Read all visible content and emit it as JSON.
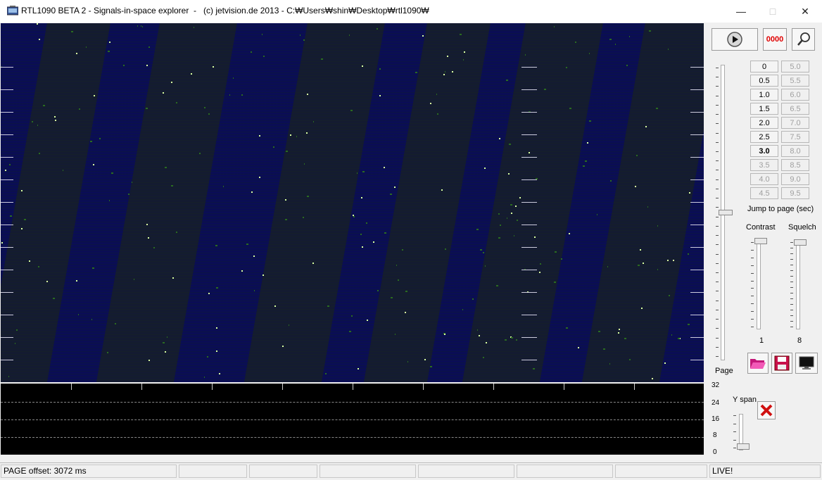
{
  "window": {
    "title": "RTL1090 BETA 2 - Signals-in-space explorer  -   (c) jetvision.de 2013 - C:₩Users₩shin₩Desktop₩rtl1090₩",
    "minimize_glyph": "—",
    "maximize_glyph": "□",
    "close_glyph": "✕"
  },
  "toolbar": {
    "play_icon": "play-icon",
    "counter_text": "0000",
    "zoom_icon": "magnifier-icon"
  },
  "jump_buttons": {
    "left": [
      {
        "label": "0",
        "state": "enabled"
      },
      {
        "label": "0.5",
        "state": "enabled"
      },
      {
        "label": "1.0",
        "state": "enabled"
      },
      {
        "label": "1.5",
        "state": "enabled"
      },
      {
        "label": "2.0",
        "state": "enabled"
      },
      {
        "label": "2.5",
        "state": "enabled"
      },
      {
        "label": "3.0",
        "state": "bold"
      },
      {
        "label": "3.5",
        "state": "disabled"
      },
      {
        "label": "4.0",
        "state": "disabled"
      },
      {
        "label": "4.5",
        "state": "disabled"
      }
    ],
    "right": [
      {
        "label": "5.0",
        "state": "disabled"
      },
      {
        "label": "5.5",
        "state": "disabled"
      },
      {
        "label": "6.0",
        "state": "disabled"
      },
      {
        "label": "6.5",
        "state": "disabled"
      },
      {
        "label": "7.0",
        "state": "disabled"
      },
      {
        "label": "7.5",
        "state": "disabled"
      },
      {
        "label": "8.0",
        "state": "disabled"
      },
      {
        "label": "8.5",
        "state": "disabled"
      },
      {
        "label": "9.0",
        "state": "disabled"
      },
      {
        "label": "9.5",
        "state": "disabled"
      }
    ],
    "caption": "Jump to page (sec)"
  },
  "page_slider": {
    "label": "Page"
  },
  "contrast": {
    "label": "Contrast",
    "value": "1"
  },
  "squelch": {
    "label": "Squelch",
    "value": "8"
  },
  "action_buttons": {
    "open_icon": "folder-open-icon",
    "save_icon": "floppy-disk-icon",
    "display_icon": "monitor-icon"
  },
  "scope": {
    "y_labels": [
      "32",
      "24",
      "16",
      "8",
      "0"
    ],
    "yspan_label": "Y span",
    "clear_icon": "red-x-icon"
  },
  "statusbar": {
    "offset_text": "PAGE offset: 3072 ms",
    "live_text": "LIVE!"
  },
  "colors": {
    "spectrogram_bg": "#0a0d55",
    "signal_dot": "#d8ffa0",
    "counter_red": "#e00000",
    "scope_bg": "#000000"
  }
}
